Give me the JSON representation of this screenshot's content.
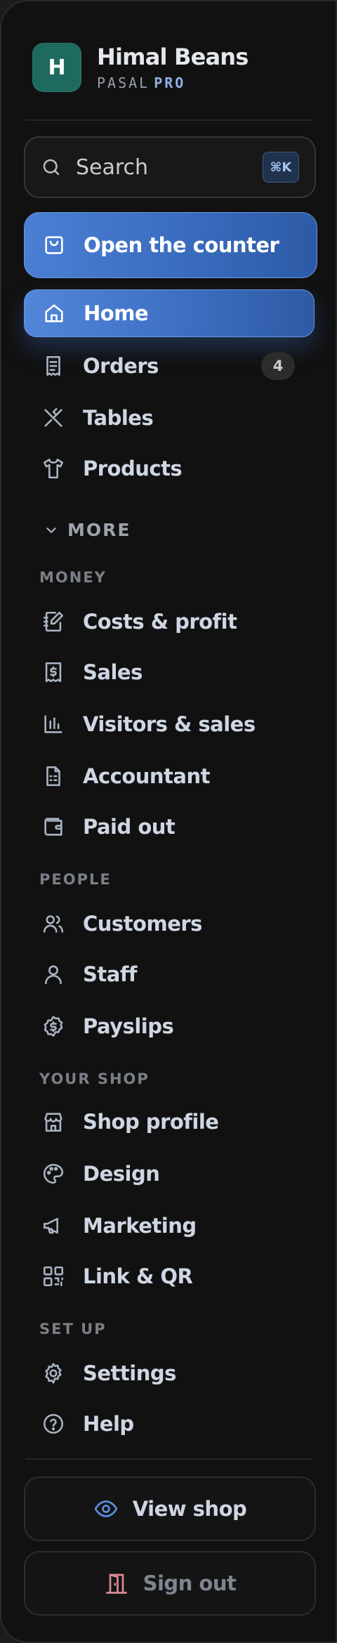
{
  "brand": {
    "initial": "H",
    "name": "Himal Beans",
    "subtitle": "PASAL",
    "tier": "PRO"
  },
  "search": {
    "label": "Search",
    "shortcut": "⌘K"
  },
  "cta": {
    "label": "Open the counter",
    "icon": "shopping-bag-icon"
  },
  "nav": {
    "home": {
      "label": "Home",
      "icon": "home-icon"
    },
    "orders": {
      "label": "Orders",
      "badge": "4",
      "icon": "receipt-icon"
    },
    "tables": {
      "label": "Tables",
      "icon": "utensils-icon"
    },
    "products": {
      "label": "Products",
      "icon": "shirt-icon"
    }
  },
  "more": {
    "label": "MORE",
    "icon": "chevron-down-icon"
  },
  "sections": {
    "money": {
      "title": "MONEY",
      "items": [
        {
          "label": "Costs & profit",
          "icon": "notebook-pen-icon"
        },
        {
          "label": "Sales",
          "icon": "receipt-dollar-icon"
        },
        {
          "label": "Visitors & sales",
          "icon": "bar-chart-icon"
        },
        {
          "label": "Accountant",
          "icon": "spreadsheet-file-icon"
        },
        {
          "label": "Paid out",
          "icon": "wallet-icon"
        }
      ]
    },
    "people": {
      "title": "PEOPLE",
      "items": [
        {
          "label": "Customers",
          "icon": "users-icon"
        },
        {
          "label": "Staff",
          "icon": "user-icon"
        },
        {
          "label": "Payslips",
          "icon": "dollar-badge-icon"
        }
      ]
    },
    "shop": {
      "title": "YOUR SHOP",
      "items": [
        {
          "label": "Shop profile",
          "icon": "store-icon"
        },
        {
          "label": "Design",
          "icon": "palette-icon"
        },
        {
          "label": "Marketing",
          "icon": "megaphone-icon"
        },
        {
          "label": "Link & QR",
          "icon": "qr-code-icon"
        }
      ]
    },
    "setup": {
      "title": "SET UP",
      "items": [
        {
          "label": "Settings",
          "icon": "gear-icon"
        },
        {
          "label": "Help",
          "icon": "help-circle-icon"
        }
      ]
    }
  },
  "footer": {
    "view_shop": {
      "label": "View shop",
      "icon": "eye-icon"
    },
    "sign_out": {
      "label": "Sign out",
      "icon": "door-icon"
    }
  },
  "colors": {
    "background": "#111111",
    "accent": "#3f71c4",
    "accent_text": "#8fb0e8",
    "logo": "#1f6a60",
    "text": "#cfd6e3",
    "muted": "#7a7f87",
    "sign_out_label": "#7f8590",
    "sign_out_icon": "#d98a95",
    "view_shop_icon": "#5a8ee0"
  }
}
